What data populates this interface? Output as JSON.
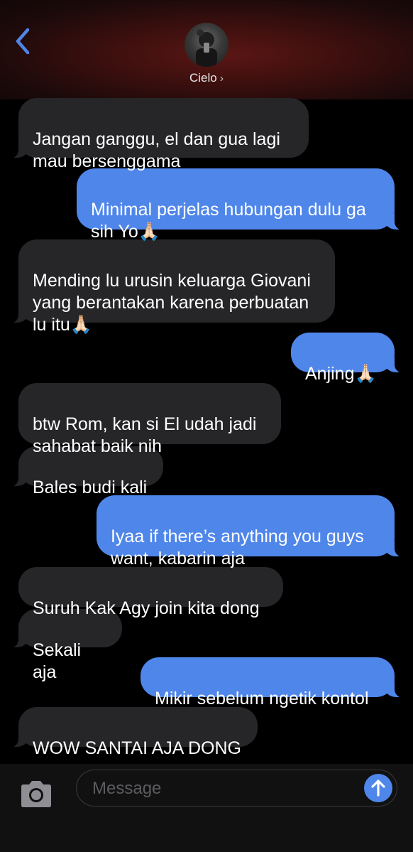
{
  "header": {
    "contact_name": "Cielo",
    "chevron": "›"
  },
  "messages": [
    {
      "from": "them",
      "text": "Jangan ganggu, el dan gua lagi\nmau bersenggama"
    },
    {
      "from": "me",
      "text": "Minimal perjelas hubungan dulu ga\nsih Yo🙏🏻"
    },
    {
      "from": "them",
      "text": "Mending lu urusin keluarga Giovani\nyang berantakan karena perbuatan\nlu itu🙏🏻"
    },
    {
      "from": "me",
      "text": "Anjing🙏🏻"
    },
    {
      "from": "them",
      "text": "btw Rom, kan si El udah jadi\nsahabat baik nih"
    },
    {
      "from": "them",
      "text": "Bales budi kali"
    },
    {
      "from": "me",
      "text": "Iyaa if there’s anything you guys\nwant, kabarin aja"
    },
    {
      "from": "them",
      "text": "Suruh Kak Agy join kita dong"
    },
    {
      "from": "them",
      "text": "Sekali aja"
    },
    {
      "from": "me",
      "text": "Mikir sebelum ngetik kontol"
    },
    {
      "from": "them",
      "text": "WOW SANTAI AJA DONG"
    }
  ],
  "input": {
    "placeholder": "Message"
  },
  "icons": {
    "back": "chevron-left-icon",
    "camera": "camera-icon",
    "send": "arrow-up-icon"
  },
  "colors": {
    "accent": "#4f86ea",
    "incoming_bubble": "#262628",
    "background": "#000000"
  }
}
